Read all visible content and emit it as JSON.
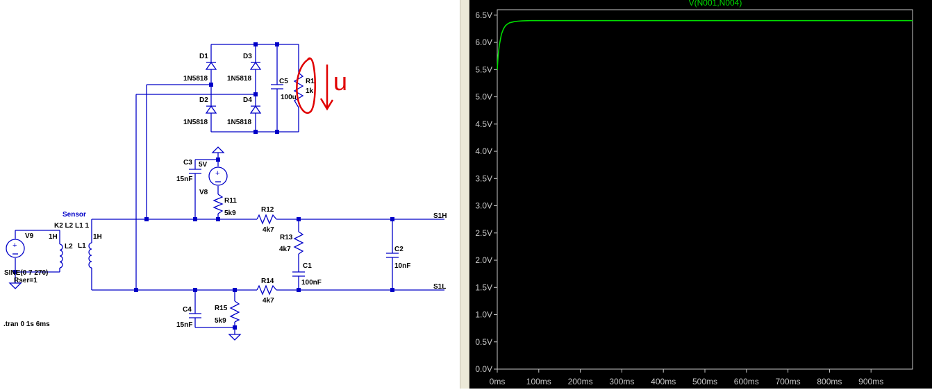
{
  "schematic": {
    "components": {
      "D1": {
        "ref": "D1",
        "model": "1N5818"
      },
      "D2": {
        "ref": "D2",
        "model": "1N5818"
      },
      "D3": {
        "ref": "D3",
        "model": "1N5818"
      },
      "D4": {
        "ref": "D4",
        "model": "1N5818"
      },
      "C5": {
        "ref": "C5",
        "value": "100u"
      },
      "R1": {
        "ref": "R1",
        "value": "1k"
      },
      "C3": {
        "ref": "C3",
        "value": "15nF"
      },
      "V8": {
        "ref": "V8",
        "value": "5V"
      },
      "R11": {
        "ref": "R11",
        "value": "5k9"
      },
      "R12": {
        "ref": "R12",
        "value": "4k7"
      },
      "R13": {
        "ref": "R13",
        "value": "4k7"
      },
      "C1": {
        "ref": "C1",
        "value": "100nF"
      },
      "C2": {
        "ref": "C2",
        "value": "10nF"
      },
      "R14": {
        "ref": "R14",
        "value": "4k7"
      },
      "C4": {
        "ref": "C4",
        "value": "15nF"
      },
      "R15": {
        "ref": "R15",
        "value": "5k9"
      },
      "V9": {
        "ref": "V9",
        "value": "SINE(0 7 270)",
        "rser": "Rser=1"
      },
      "L1": {
        "ref": "L1",
        "value": "1H"
      },
      "L2": {
        "ref": "L2",
        "value": "1H"
      }
    },
    "sensor_label": "Sensor",
    "coupling": "K2 L2 L1 1",
    "nets": {
      "s1h": "S1H",
      "s1l": "S1L"
    },
    "directive": ".tran 0 1s 6ms",
    "annotation": {
      "color": "#e00000",
      "text": "u"
    }
  },
  "chart_data": {
    "type": "line",
    "title": "V(N001,N004)",
    "xlabel": "",
    "ylabel": "",
    "xlim": [
      0,
      1000
    ],
    "ylim": [
      0.0,
      6.6
    ],
    "x_ticks": [
      "0ms",
      "100ms",
      "200ms",
      "300ms",
      "400ms",
      "500ms",
      "600ms",
      "700ms",
      "800ms",
      "900ms"
    ],
    "y_ticks": [
      "0.0V",
      "0.5V",
      "1.0V",
      "1.5V",
      "2.0V",
      "2.5V",
      "3.0V",
      "3.5V",
      "4.0V",
      "4.5V",
      "5.0V",
      "5.5V",
      "6.0V",
      "6.5V"
    ],
    "series": [
      {
        "name": "V(N001,N004)",
        "color": "#00dd00",
        "x": [
          0,
          2,
          5,
          10,
          15,
          20,
          25,
          30,
          40,
          50,
          60,
          80,
          100,
          200,
          400,
          600,
          800,
          1000
        ],
        "y": [
          5.5,
          5.75,
          5.95,
          6.15,
          6.25,
          6.31,
          6.34,
          6.36,
          6.38,
          6.39,
          6.395,
          6.4,
          6.4,
          6.4,
          6.4,
          6.4,
          6.4,
          6.4
        ]
      }
    ],
    "grid": false,
    "background": "#000000",
    "axis_color": "#c8c8c8"
  }
}
